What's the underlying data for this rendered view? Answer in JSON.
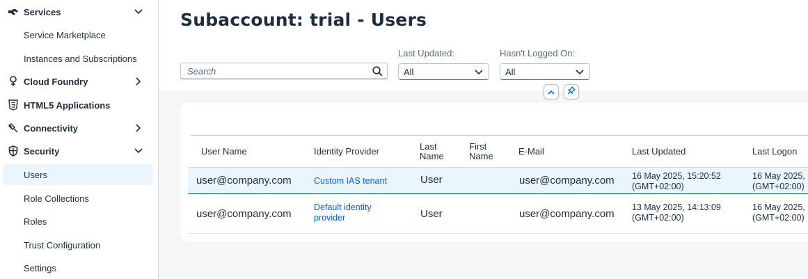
{
  "sidebar": {
    "services": {
      "label": "Services",
      "items": [
        "Service Marketplace",
        "Instances and Subscriptions"
      ]
    },
    "cloud_foundry": {
      "label": "Cloud Foundry"
    },
    "html5": {
      "label": "HTML5 Applications"
    },
    "connectivity": {
      "label": "Connectivity"
    },
    "security": {
      "label": "Security",
      "items": [
        "Users",
        "Role Collections",
        "Roles",
        "Trust Configuration",
        "Settings"
      ],
      "selected": "Users"
    }
  },
  "header": {
    "title": "Subaccount: trial - Users",
    "search": {
      "placeholder": "Search",
      "value": ""
    },
    "filters": [
      {
        "label": "Last Updated:",
        "value": "All"
      },
      {
        "label": "Hasn't Logged On:",
        "value": "All"
      }
    ]
  },
  "table": {
    "columns": [
      "User Name",
      "Identity Provider",
      "Last Name",
      "First Name",
      "E-Mail",
      "Last Updated",
      "Last Logon"
    ],
    "column_lines": {
      "last_name": [
        "Last",
        "Name"
      ],
      "first_name": [
        "First",
        "Name"
      ]
    },
    "rows": [
      {
        "user_name": "user@company.com",
        "identity_provider": [
          "Custom IAS tenant"
        ],
        "last_name": "User",
        "first_name": "",
        "email": "user@company.com",
        "last_updated": [
          "16 May 2025, 15:20:52",
          "(GMT+02:00)"
        ],
        "last_logon": [
          "16 May 2025,",
          "(GMT+02:00)"
        ],
        "selected": true
      },
      {
        "user_name": "user@company.com",
        "identity_provider": [
          "Default identity",
          "provider"
        ],
        "last_name": "User",
        "first_name": "",
        "email": "user@company.com",
        "last_updated": [
          "13 May 2025, 14:13:09",
          "(GMT+02:00)"
        ],
        "last_logon": [
          "16 May 2025,",
          "(GMT+02:00)"
        ],
        "selected": false
      }
    ]
  },
  "colors": {
    "accent": "#0064d9",
    "selected_bg": "#ebf5fe",
    "text": "#1d2d3e"
  }
}
